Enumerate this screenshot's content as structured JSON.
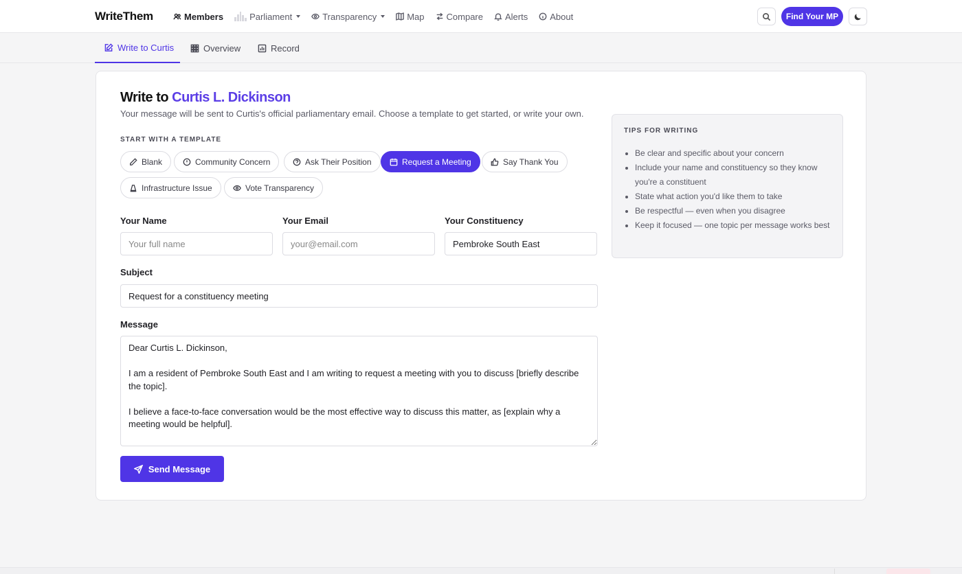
{
  "app": {
    "brand": "WriteThem"
  },
  "nav": {
    "members": "Members",
    "parliament": "Parliament",
    "transparency": "Transparency",
    "map": "Map",
    "compare": "Compare",
    "alerts": "Alerts",
    "about": "About",
    "find_mp": "Find Your MP"
  },
  "subnav": {
    "write": "Write to Curtis",
    "overview": "Overview",
    "record": "Record"
  },
  "page": {
    "title_prefix": "Write to ",
    "title_name": "Curtis L. Dickinson",
    "subtitle": "Your message will be sent to Curtis's official parliamentary email. Choose a template to get started, or write your own.",
    "template_label": "START WITH A TEMPLATE"
  },
  "templates": {
    "blank": "Blank",
    "community": "Community Concern",
    "ask": "Ask Their Position",
    "meeting": "Request a Meeting",
    "thanks": "Say Thank You",
    "infrastructure": "Infrastructure Issue",
    "vote": "Vote Transparency"
  },
  "form": {
    "name_label": "Your Name",
    "name_placeholder": "Your full name",
    "email_label": "Your Email",
    "email_placeholder": "your@email.com",
    "constituency_label": "Your Constituency",
    "constituency_value": "Pembroke South East",
    "subject_label": "Subject",
    "subject_value": "Request for a constituency meeting",
    "message_label": "Message",
    "message_value": "Dear Curtis L. Dickinson,\n\nI am a resident of Pembroke South East and I am writing to request a meeting with you to discuss [briefly describe the topic].\n\nI believe a face-to-face conversation would be the most effective way to discuss this matter, as [explain why a meeting would be helpful].\n\nI am available for a time at your availability, and please suggest specific dates] and I look forward to meeting",
    "send_label": "Send Message"
  },
  "tips": {
    "title": "TIPS FOR WRITING",
    "items": [
      "Be clear and specific about your concern",
      "Include your name and constituency so they know you're a constituent",
      "State what action you'd like them to take",
      "Be respectful — even when you disagree",
      "Keep it focused — one topic per message works best"
    ]
  },
  "colors": {
    "accent": "#4f35e6",
    "mp_name": "#5b3ee6"
  }
}
